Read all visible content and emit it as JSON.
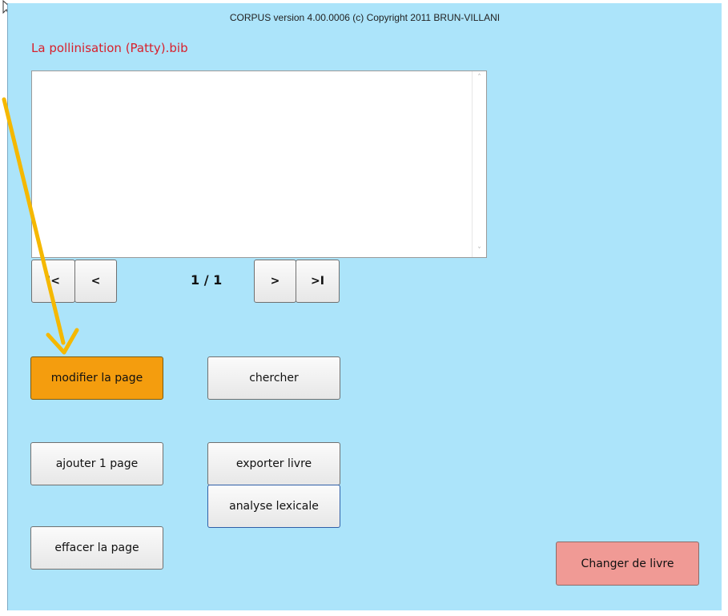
{
  "window": {
    "title": "CORPUS version 4.00.0006 (c) Copyright 2011 BRUN-VILLANI",
    "background": "#ace4fa"
  },
  "document": {
    "filename": "La pollinisation (Patty).bib",
    "text": ""
  },
  "navigation": {
    "first_label": "I<",
    "prev_label": "<",
    "page_counter": "1 / 1",
    "next_label": ">",
    "last_label": ">I"
  },
  "actions": {
    "modify_page": "modifier la page",
    "search": "chercher",
    "add_page": "ajouter 1 page",
    "export_book": "exporter livre",
    "lexical_analysis": "analyse lexicale",
    "delete_page": "effacer la page",
    "change_book": "Changer de livre"
  },
  "colors": {
    "modify_button": "#f49d0e",
    "change_book_button": "#f09a95",
    "annotation_arrow": "#f5b800",
    "filename_text": "#d8202c"
  },
  "icons": {
    "cursor": "mouse-pointer-icon",
    "annotation": "annotation-arrow-icon"
  }
}
